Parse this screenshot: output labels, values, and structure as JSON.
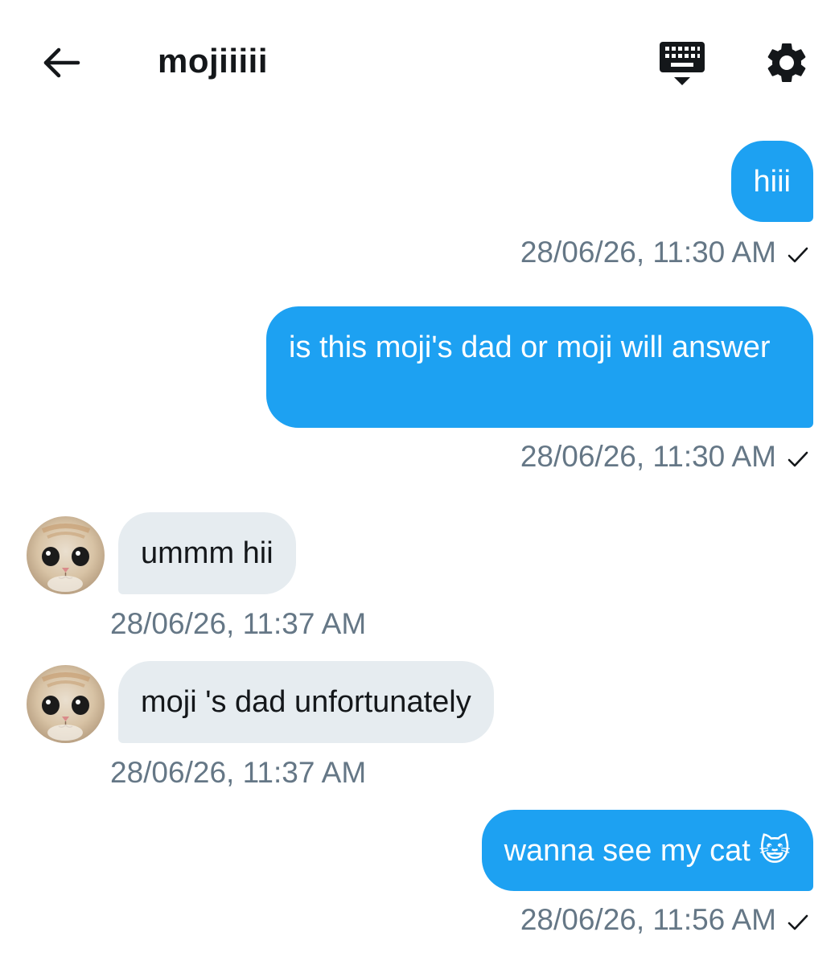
{
  "header": {
    "title": "mojiiiii",
    "back_icon": "arrow-left-icon",
    "keyboard_icon": "keyboard-icon",
    "settings_icon": "gear-icon"
  },
  "colors": {
    "outgoing_bubble": "#1da1f2",
    "incoming_bubble": "#e6ecf0",
    "timestamp": "#657786"
  },
  "messages": [
    {
      "direction": "out",
      "text": "hiii",
      "timestamp": "28/06/26, 11:30 AM",
      "sent_mark": "✓"
    },
    {
      "direction": "out",
      "text": "is this moji's dad or moji will answer",
      "timestamp": "28/06/26, 11:30 AM",
      "sent_mark": "✓"
    },
    {
      "direction": "in",
      "text": "ummm hii",
      "timestamp": "28/06/26, 11:37 AM"
    },
    {
      "direction": "in",
      "text": "moji 's dad unfortunately",
      "timestamp": "28/06/26, 11:37 AM"
    },
    {
      "direction": "out",
      "text": "wanna see my cat 😺",
      "timestamp": "28/06/26, 11:56 AM",
      "sent_mark": "✓"
    }
  ]
}
